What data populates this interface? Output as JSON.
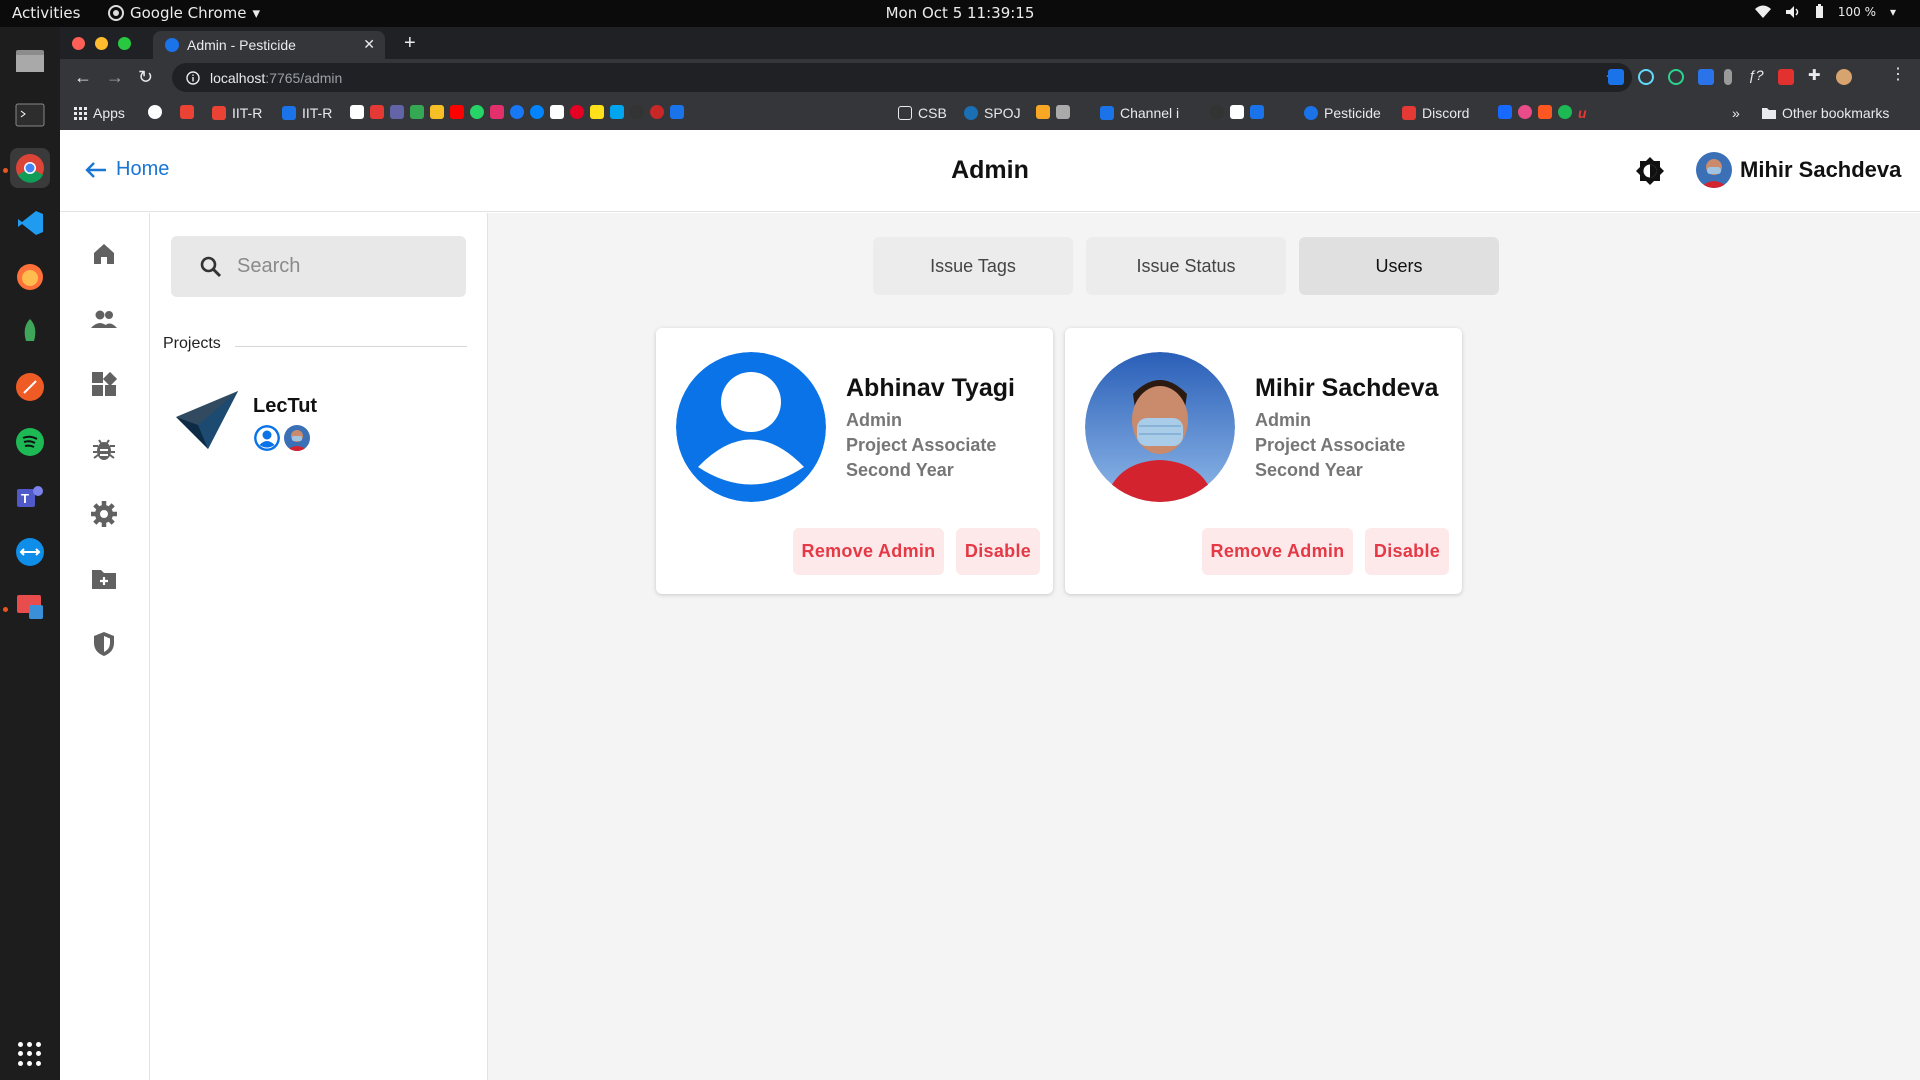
{
  "system": {
    "activities": "Activities",
    "app_menu": "Google Chrome",
    "clock": "Mon Oct 5  11:39:15",
    "battery": "100 %"
  },
  "browser": {
    "tab_title": "Admin - Pesticide",
    "url_host": "localhost",
    "url_path": ":7765/admin",
    "bookmarks": [
      {
        "label": "Apps",
        "icon": "apps-grid-icon"
      },
      {
        "label": "",
        "icon": "google-icon"
      },
      {
        "label": "",
        "icon": "gmail-icon"
      },
      {
        "label": "IIT-R",
        "icon": "gmail-icon"
      },
      {
        "label": "IIT-R",
        "icon": "calendar-icon"
      },
      {
        "label": "CSB",
        "icon": "codesandbox-icon"
      },
      {
        "label": "SPOJ",
        "icon": "spoj-icon"
      },
      {
        "label": "Channel i",
        "icon": "channel-icon"
      },
      {
        "label": "Pesticide",
        "icon": "pesticide-icon"
      },
      {
        "label": "Discord",
        "icon": "discord-icon"
      }
    ],
    "other_bookmarks": "Other bookmarks",
    "overflow": "»"
  },
  "header": {
    "home_label": "Home",
    "title": "Admin",
    "user_name": "Mihir Sachdeva"
  },
  "nav": [
    "home-icon",
    "people-icon",
    "dashboard-icon",
    "bug-icon",
    "settings-icon",
    "new-folder-icon",
    "shield-icon"
  ],
  "sidebar": {
    "search_placeholder": "Search",
    "projects_heading": "Projects",
    "project": {
      "name": "LecTut",
      "icon": "paper-plane-icon"
    }
  },
  "tabs": [
    {
      "label": "Issue Tags",
      "active": false
    },
    {
      "label": "Issue Status",
      "active": false
    },
    {
      "label": "Users",
      "active": true
    }
  ],
  "users": [
    {
      "name": "Abhinav Tyagi",
      "role": "Admin",
      "designation": "Project Associate",
      "year": "Second Year",
      "remove_label": "Remove Admin",
      "disable_label": "Disable"
    },
    {
      "name": "Mihir Sachdeva",
      "role": "Admin",
      "designation": "Project Associate",
      "year": "Second Year",
      "remove_label": "Remove Admin",
      "disable_label": "Disable"
    }
  ],
  "colors": {
    "accent": "#1976d2",
    "avatar_blue": "#0a73e8",
    "danger": "#e53946",
    "danger_bg": "#fde8ea"
  }
}
